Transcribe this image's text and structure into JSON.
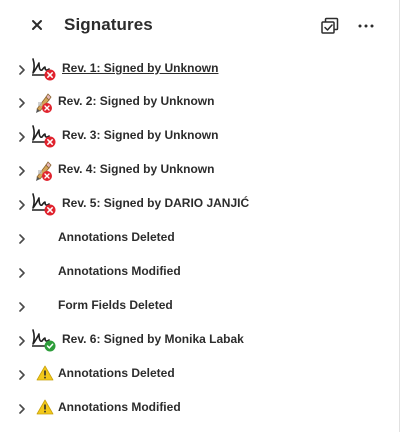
{
  "panel": {
    "title": "Signatures"
  },
  "items": [
    {
      "label": "Rev. 1: Signed by Unknown",
      "icon": "signature-invalid-icon"
    },
    {
      "label": "Rev. 2: Signed by Unknown",
      "icon": "signature-unknown-icon"
    },
    {
      "label": "Rev. 3: Signed by Unknown",
      "icon": "signature-invalid-icon"
    },
    {
      "label": "Rev. 4: Signed by Unknown",
      "icon": "signature-unknown-icon"
    },
    {
      "label": "Rev. 5: Signed by DARIO JANJIĆ",
      "icon": "signature-invalid-icon"
    },
    {
      "label": "Annotations Deleted"
    },
    {
      "label": "Annotations Modified"
    },
    {
      "label": "Form Fields Deleted"
    },
    {
      "label": "Rev. 6: Signed by Monika Labak",
      "icon": "signature-valid-icon"
    },
    {
      "label": "Annotations Deleted",
      "icon": "warning-icon"
    },
    {
      "label": "Annotations Modified",
      "icon": "warning-icon"
    }
  ],
  "colors": {
    "invalid": "#e0232e",
    "valid": "#2d9d3a",
    "warning": "#f2c81a",
    "text": "#2c2c2c"
  }
}
